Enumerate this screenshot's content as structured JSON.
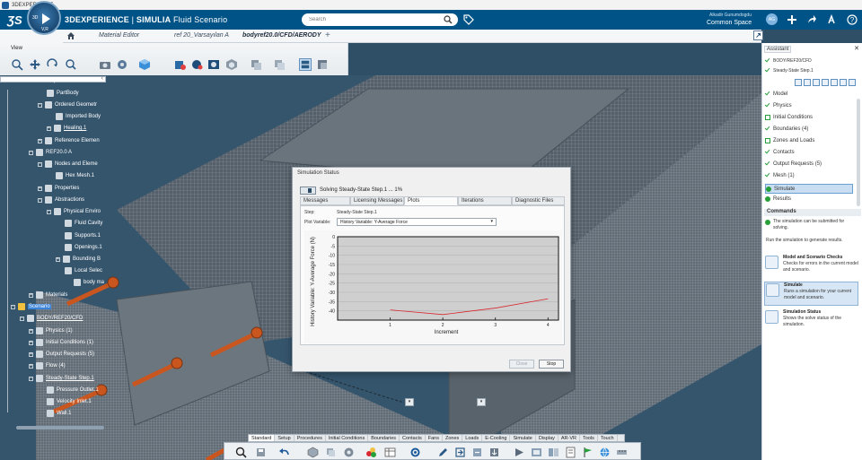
{
  "os": {
    "title": "3DEXPERIENCE"
  },
  "header": {
    "brand": "3DEXPERIENCE",
    "separator": " | ",
    "product": "SIMULIA",
    "app": "Fluid Scenario",
    "search_placeholder": "Search",
    "user_name": "Alkadir Gunumdogdu",
    "space": "Common Space",
    "avatar_initials": "AG",
    "compass_3d": "3D",
    "compass_vr": "V,R"
  },
  "tabs": [
    {
      "label": "Material Editor"
    },
    {
      "label": "ref 20_Varsayılan A"
    },
    {
      "label": "bodyref20.0/CFD/AERODY"
    }
  ],
  "toolbar": {
    "view_label": "View"
  },
  "tree": {
    "nodes": [
      {
        "label": "zx plane"
      },
      {
        "label": "PartBody"
      },
      {
        "label": "Ordered Geometr"
      },
      {
        "label": "Imported Body"
      },
      {
        "label": "Healing.1"
      },
      {
        "label": "Reference Elemen"
      },
      {
        "label": "REF20.0 A"
      },
      {
        "label": "Nodes and Eleme"
      },
      {
        "label": "Hex Mesh.1"
      },
      {
        "label": "Properties"
      },
      {
        "label": "Abstractions"
      },
      {
        "label": "Physical Enviro"
      },
      {
        "label": "Fluid Cavity"
      },
      {
        "label": "Supports.1"
      },
      {
        "label": "Openings.1"
      },
      {
        "label": "Bounding B"
      },
      {
        "label": "Local Selec"
      },
      {
        "label": "body ma"
      },
      {
        "label": "Materials"
      },
      {
        "label": "Scenario"
      },
      {
        "label": "BODY/REF20/CFD"
      },
      {
        "label": "Physics (1)"
      },
      {
        "label": "Initial Conditions (1)"
      },
      {
        "label": "Output Requests (5)"
      },
      {
        "label": "Flow (4)"
      },
      {
        "label": "Steady-State Step.1"
      },
      {
        "label": "Pressure Outlet.1"
      },
      {
        "label": "Velocity Inlet.1"
      },
      {
        "label": "Wall.1"
      }
    ]
  },
  "dialog": {
    "title": "Simulation Status",
    "status_text": "Solving Steady-State Step.1 ... 1%",
    "tabs": [
      {
        "label": "Messages"
      },
      {
        "label": "Licensing Messages"
      },
      {
        "label": "Plots"
      },
      {
        "label": "Iterations"
      },
      {
        "label": "Diagnostic Files"
      }
    ],
    "step_label": "Step:",
    "step_value": "Steady-State Step.1",
    "plot_variable_label": "Plot Variable:",
    "plot_variable_value": "History Variable: Y-Average Force",
    "close_label": "Close",
    "stop_label": "Stop"
  },
  "chart_data": {
    "type": "line",
    "title": "",
    "xlabel": "Increment",
    "ylabel": "History Variable: Y-Average Force (N)",
    "xlim": [
      0,
      4.2
    ],
    "ylim": [
      -45,
      0
    ],
    "x_ticks": [
      "1",
      "2",
      "3",
      "4"
    ],
    "y_ticks": [
      "0",
      "-5",
      "-10",
      "-15",
      "-20",
      "-25",
      "-30",
      "-35",
      "-40"
    ],
    "grid": true,
    "series": [
      {
        "color": "#d9282f",
        "x": [
          1,
          2,
          3,
          4
        ],
        "y": [
          -39.5,
          -42,
          -38.5,
          -33.5
        ]
      }
    ]
  },
  "assistant": {
    "title": "Assistant",
    "breadcrumb_1": "BODY/REF20/CFD",
    "breadcrumb_2": "Steady-State Step.1",
    "items": [
      {
        "label": "Model",
        "state": "done"
      },
      {
        "label": "Physics",
        "state": "done"
      },
      {
        "label": "Initial Conditions",
        "state": "empty"
      },
      {
        "label": "Boundaries (4)",
        "state": "done"
      },
      {
        "label": "Zones and Loads",
        "state": "empty"
      },
      {
        "label": "Contacts",
        "state": "done"
      },
      {
        "label": "Output Requests (5)",
        "state": "done"
      },
      {
        "label": "Mesh (1)",
        "state": "done"
      },
      {
        "label": "Simulate",
        "state": "dot"
      },
      {
        "label": "Results",
        "state": "dot"
      }
    ],
    "commands_header": "Commands",
    "status_msg": "The simulation can be submitted for solving.",
    "hint_msg": "Run the simulation to generate results.",
    "commands": [
      {
        "title": "Model and Scenario Checks",
        "desc": "Checks for errors in the current model and scenario."
      },
      {
        "title": "Simulate",
        "desc": "Runs a simulation for your current model and scenario."
      },
      {
        "title": "Simulation Status",
        "desc": "Shows the solve status of the simulation."
      }
    ]
  },
  "bottom_tabs": [
    {
      "label": "Standard"
    },
    {
      "label": "Setup"
    },
    {
      "label": "Procedures"
    },
    {
      "label": "Initial Conditions"
    },
    {
      "label": "Boundaries"
    },
    {
      "label": "Contacts"
    },
    {
      "label": "Fans"
    },
    {
      "label": "Zones"
    },
    {
      "label": "Loads"
    },
    {
      "label": "E-Cooling"
    },
    {
      "label": "Simulate"
    },
    {
      "label": "Display"
    },
    {
      "label": "AR-VR"
    },
    {
      "label": "Tools"
    },
    {
      "label": "Touch"
    }
  ],
  "colors": {
    "header_bg": "#005386",
    "viewport_bg": "#35556d",
    "accent_green": "#27a03a",
    "series_red": "#d9282f",
    "bolt_orange": "#c9561f"
  }
}
